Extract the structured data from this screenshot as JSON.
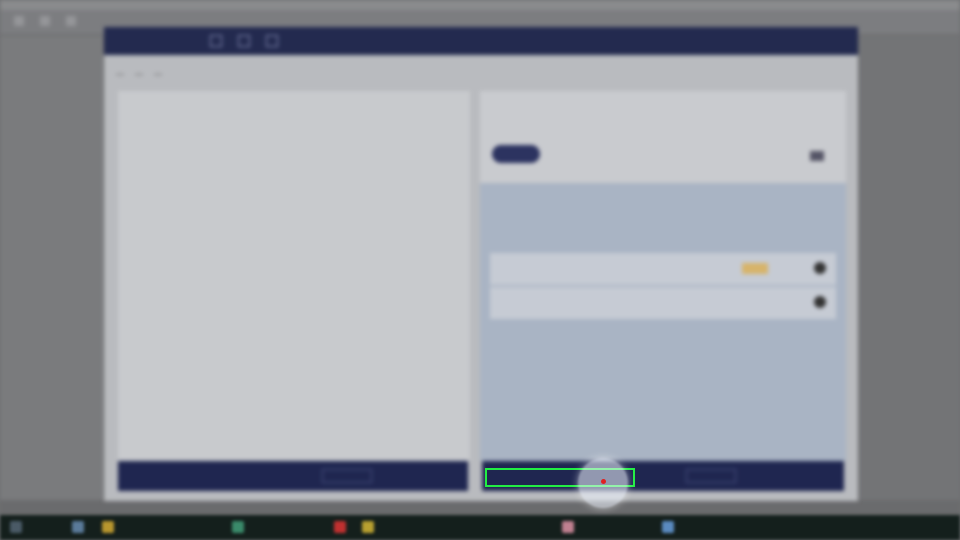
{
  "background_app": {
    "title": "",
    "right_menu": "",
    "sidebar_rows": [
      "",
      "",
      "",
      "",
      "",
      ""
    ],
    "sidebar_big_value": ""
  },
  "modal": {
    "title": "",
    "breadcrumbs": [
      "",
      "",
      ""
    ],
    "editor_lines": [
      "",
      "",
      "",
      "",
      "",
      "",
      "",
      "",
      "",
      "",
      "",
      ""
    ],
    "result": {
      "search_placeholder": "",
      "card_title": "",
      "card_subtitle": "",
      "section_title": "",
      "section_subtitle": "",
      "items": [
        {
          "key": "",
          "description": "",
          "count": ""
        },
        {
          "key": "",
          "description": "",
          "count": ""
        }
      ]
    },
    "left_bar_label": "",
    "right_bar_label": ""
  },
  "taskbar": {
    "apps": [
      "",
      "",
      "",
      "",
      "",
      ""
    ],
    "clock": ""
  },
  "colors": {
    "modal_header": "#232a4f",
    "highlight": "#22ee44",
    "cursor_dot": "#e02020",
    "badge": "#d7b46a"
  }
}
